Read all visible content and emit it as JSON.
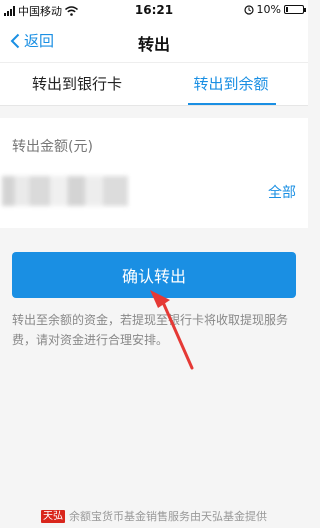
{
  "status_bar": {
    "carrier": "中国移动",
    "time": "16:21",
    "battery_percent": "10%",
    "battery_level": 0.1
  },
  "nav": {
    "back_label": "返回",
    "title": "转出"
  },
  "tabs": [
    {
      "label": "转出到银行卡",
      "selected": false
    },
    {
      "label": "转出到余额",
      "selected": true
    }
  ],
  "amount": {
    "label": "转出金额(元)",
    "all_label": "全部"
  },
  "confirm_label": "确认转出",
  "notice": "转出至余额的资金，若提现至银行卡将收取提现服务费，请对资金进行合理安排。",
  "footer": {
    "logo_text": "天弘",
    "text": "余额宝货币基金销售服务由天弘基金提供"
  },
  "colors": {
    "accent": "#1a8fe3",
    "annotation_arrow": "#e53935",
    "footer_logo": "#d9261c"
  },
  "icons": [
    "signal-icon",
    "wifi-icon",
    "alarm-icon",
    "battery-icon",
    "chevron-left-icon"
  ]
}
